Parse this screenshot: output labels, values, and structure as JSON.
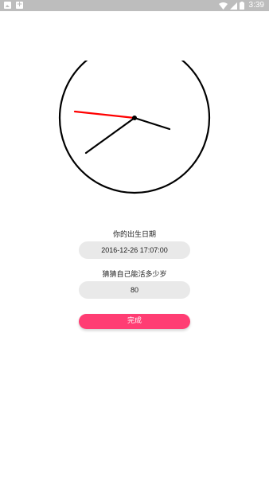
{
  "status_bar": {
    "time": "3:39",
    "notification_icons": [
      "image-icon",
      "add-icon"
    ],
    "system_icons": [
      "wifi-icon",
      "signal-icon",
      "battery-icon"
    ]
  },
  "clock": {
    "hour_hand_color": "#000000",
    "minute_hand_color": "#000000",
    "second_hand_color": "#ff0000",
    "face_color": "#ffffff",
    "rim_color": "#000000"
  },
  "form": {
    "birth_label": "你的出生日期",
    "birth_value": "2016-12-26 17:07:00",
    "guess_label": "猜猜自己能活多少岁",
    "guess_value": "80",
    "submit_label": "完成"
  },
  "colors": {
    "accent": "#ff3d73",
    "field_bg": "#e9e9e9",
    "status_bar_bg": "#bdbdbd"
  }
}
